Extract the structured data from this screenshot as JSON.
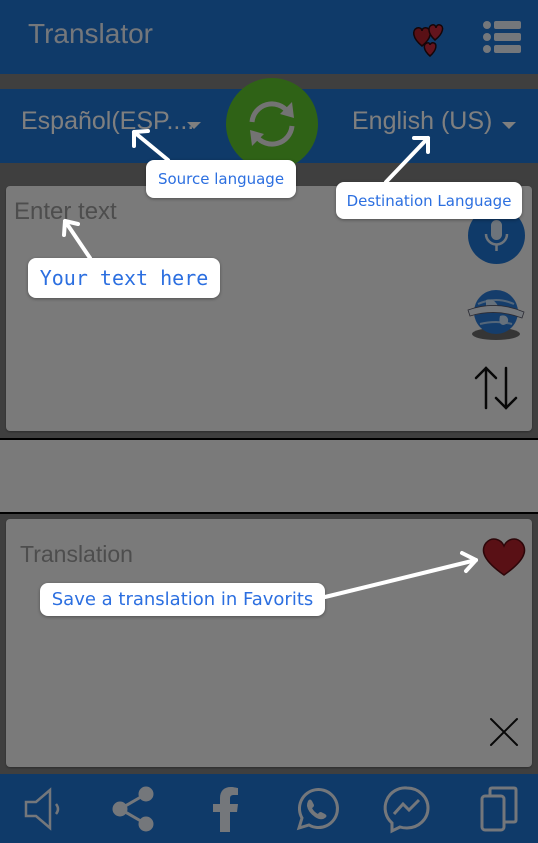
{
  "app": {
    "title": "Translator"
  },
  "languages": {
    "source": "Español(ESP....",
    "destination": "English (US)"
  },
  "input": {
    "placeholder": "Enter text"
  },
  "output": {
    "placeholder": "Translation"
  },
  "tutorial": {
    "source_hint": "Source language",
    "destination_hint": "Destination Language",
    "text_hint": "Your text here",
    "favorites_hint": "Save a translation in Favorits"
  },
  "icons": {
    "top": [
      "hearts-icon",
      "menu-icon"
    ],
    "bottom": [
      "speaker-icon",
      "share-icon",
      "facebook-icon",
      "whatsapp-icon",
      "messenger-icon",
      "copy-icon"
    ]
  },
  "colors": {
    "primary": "#1f74d2",
    "swap_button": "#5fc42c",
    "heart": "#b3202a",
    "hint_text": "#2c6fe0"
  }
}
